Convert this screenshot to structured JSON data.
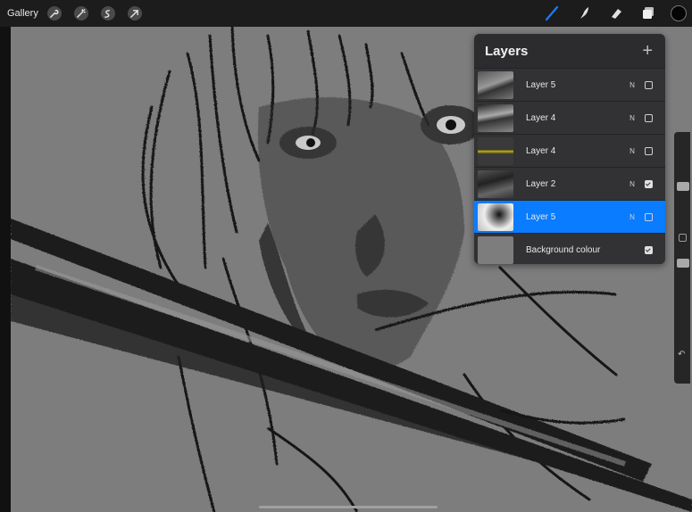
{
  "app": {
    "gallery_label": "Gallery"
  },
  "toolbar": {
    "left_tools": [
      "wrench-icon",
      "magic-wand-icon",
      "selection-icon",
      "transform-arrow-icon"
    ],
    "right_tools": [
      "brush-icon",
      "smudge-icon",
      "eraser-icon",
      "layers-icon"
    ],
    "active_tool": "brush-icon",
    "accent_color": "#1a7cff",
    "current_color": "#050505"
  },
  "layers_panel": {
    "title": "Layers",
    "add_label": "+",
    "layers": [
      {
        "name": "Layer 5",
        "mode": "N",
        "visible": false,
        "active": false
      },
      {
        "name": "Layer 4",
        "mode": "N",
        "visible": false,
        "active": false
      },
      {
        "name": "Layer 4",
        "mode": "N",
        "visible": false,
        "active": false
      },
      {
        "name": "Layer 2",
        "mode": "N",
        "visible": true,
        "active": false
      },
      {
        "name": "Layer 5",
        "mode": "N",
        "visible": false,
        "active": true
      }
    ],
    "background": {
      "name": "Background colour",
      "visible": true
    }
  },
  "sidebar": {
    "size_slider": 0.25,
    "opacity_slider": 0.5,
    "undo_label": "↶"
  }
}
